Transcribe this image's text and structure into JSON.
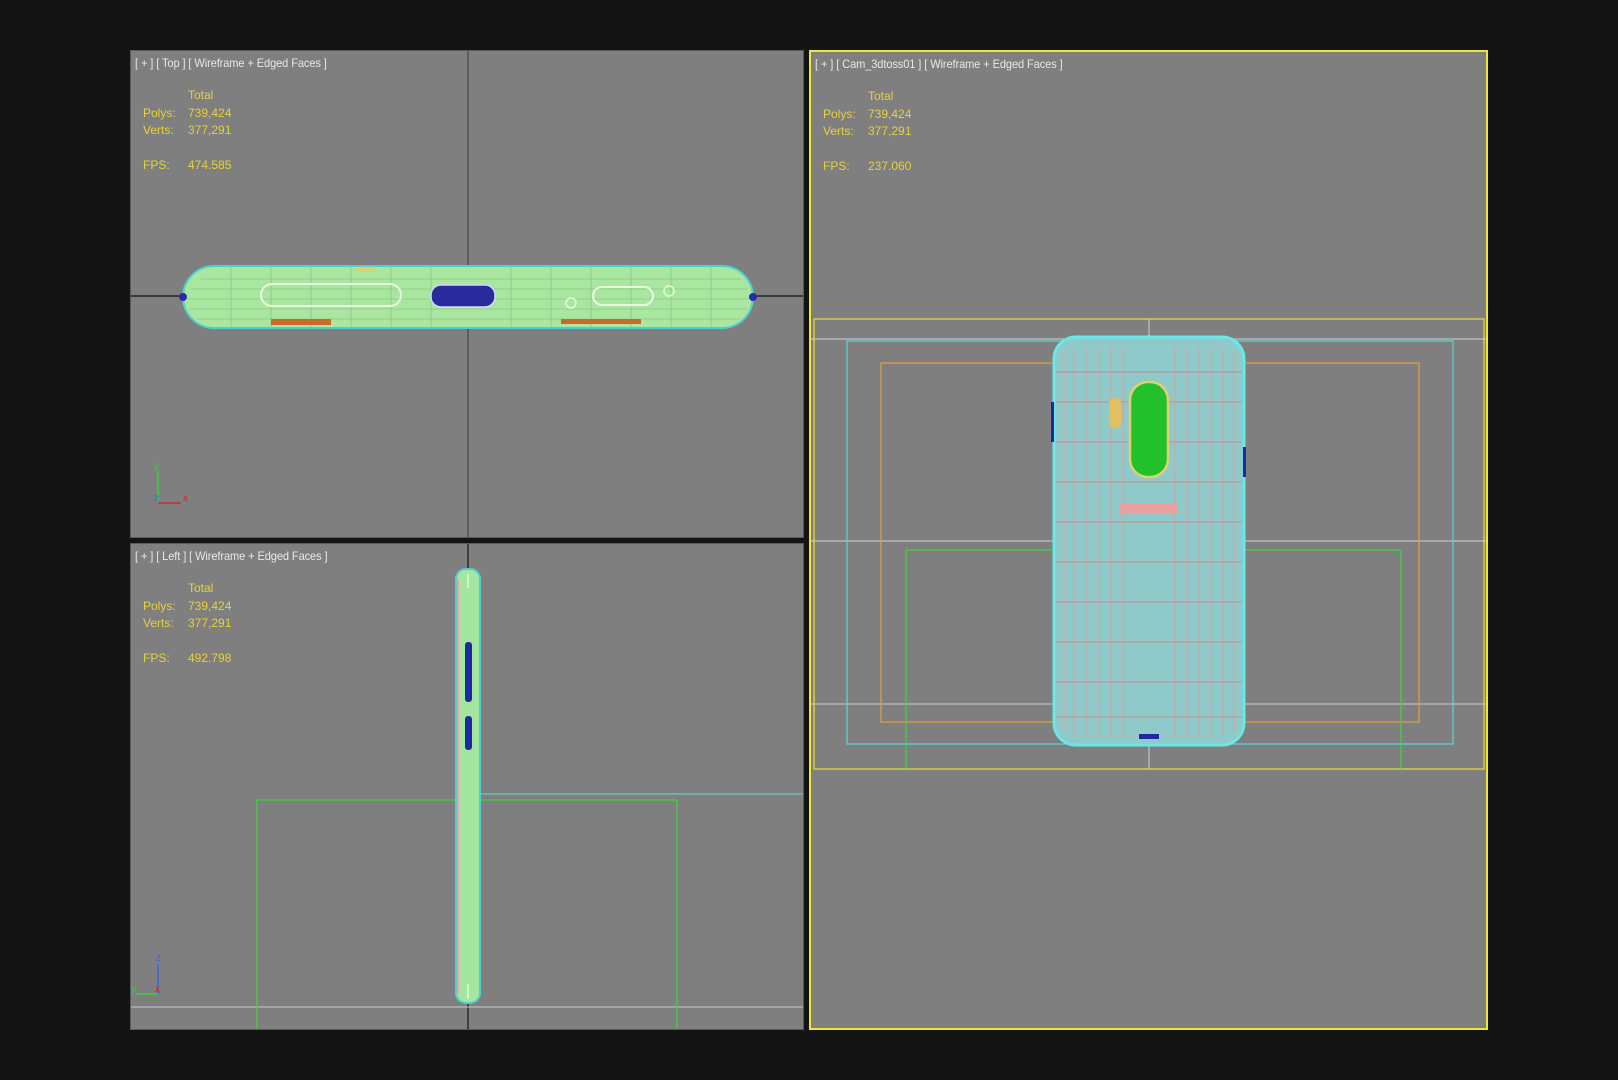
{
  "viewports": {
    "top": {
      "label": "[ + ] [ Top ] [ Wireframe + Edged Faces ]",
      "total_label": "Total",
      "polys_label": "Polys:",
      "polys": "739,424",
      "verts_label": "Verts:",
      "verts": "377,291",
      "fps_label": "FPS:",
      "fps": "474.585",
      "axis": {
        "a": "y",
        "b": "z",
        "c": "x"
      }
    },
    "left": {
      "label": "[ + ] [ Left ] [ Wireframe + Edged Faces ]",
      "total_label": "Total",
      "polys_label": "Polys:",
      "polys": "739,424",
      "verts_label": "Verts:",
      "verts": "377,291",
      "fps_label": "FPS:",
      "fps": "492.798",
      "axis": {
        "a": "z",
        "b": "y",
        "c": "x"
      }
    },
    "camera": {
      "label": "[ + ] [ Cam_3dtoss01 ] [ Wireframe + Edged Faces ]",
      "total_label": "Total",
      "polys_label": "Polys:",
      "polys": "739,424",
      "verts_label": "Verts:",
      "verts": "377,291",
      "fps_label": "FPS:",
      "fps": "237.060"
    }
  },
  "colors": {
    "viewport_bg": "#7f7f7f",
    "active_border": "#f0e63a",
    "stats_text": "#e6d23a",
    "wire_green": "#9ee89a",
    "wire_cyan": "#66e0e0",
    "wire_orange": "#e0a23a",
    "wire_pink": "#f0a0a0",
    "blue_buttons": "#1c2a9c"
  }
}
